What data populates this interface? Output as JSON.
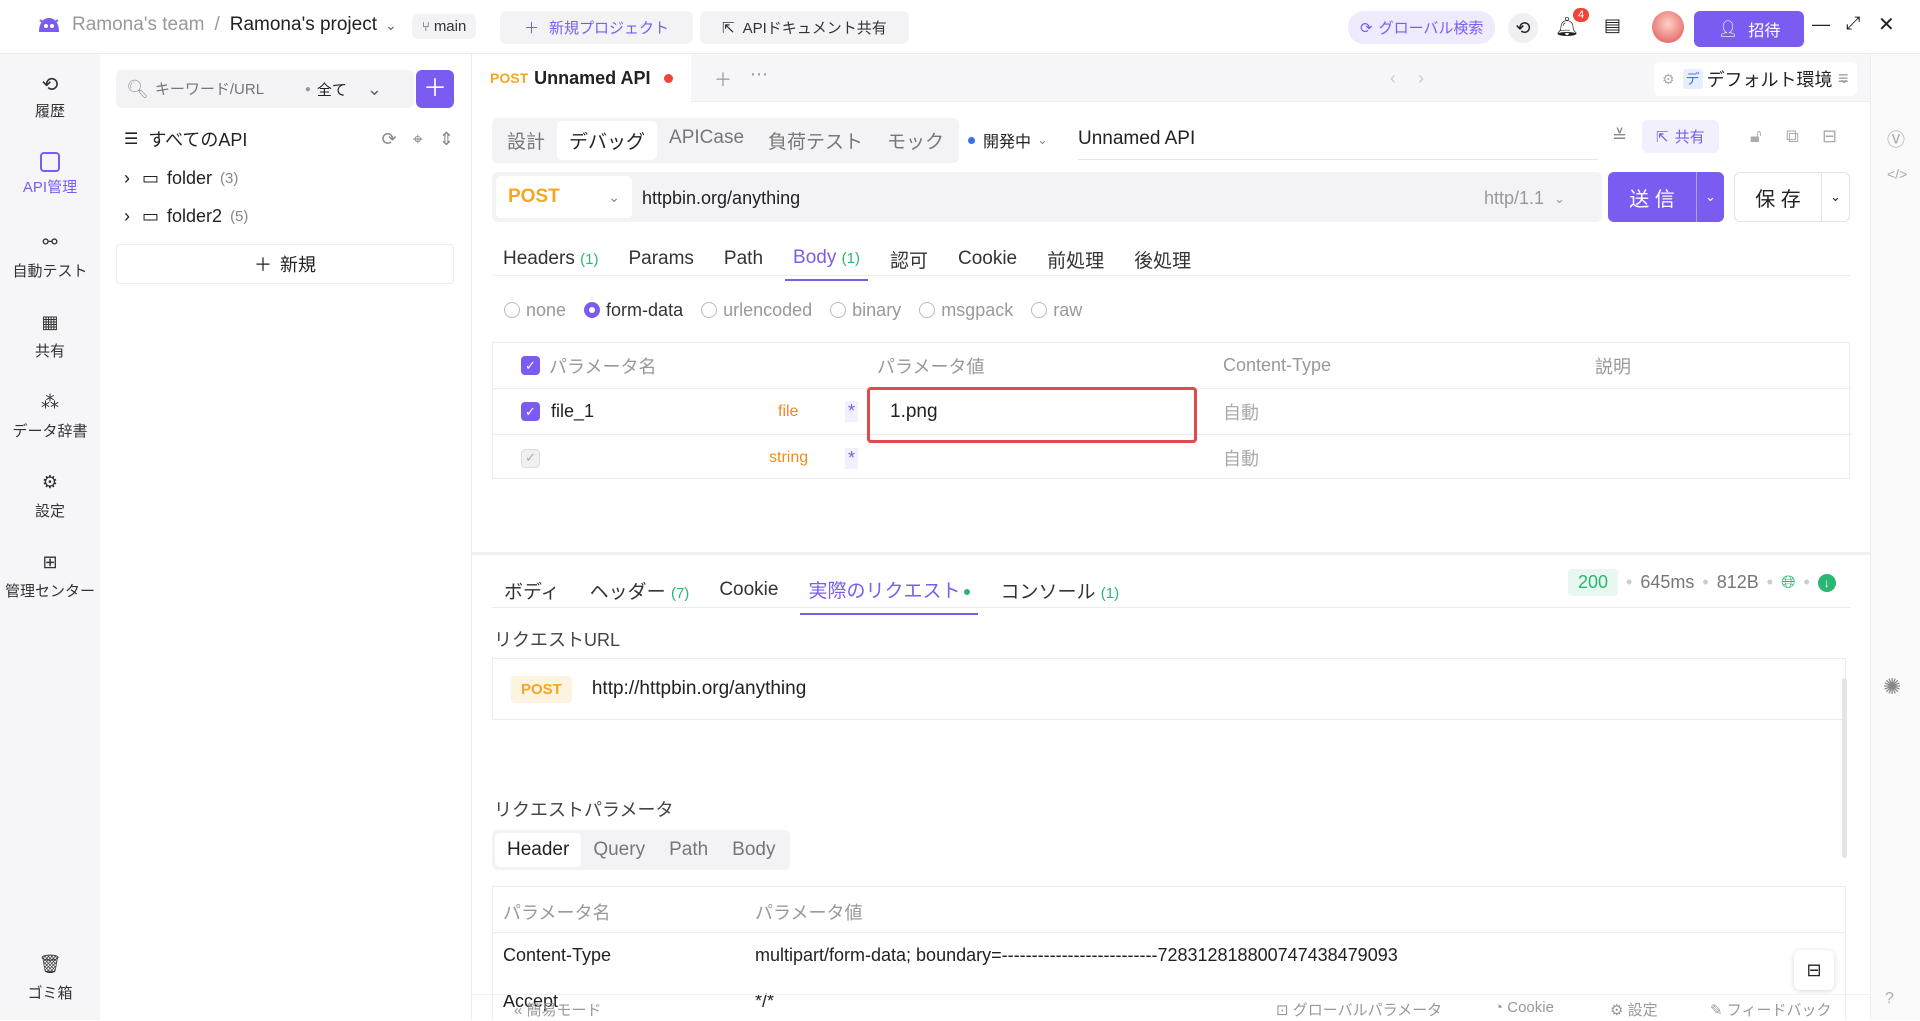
{
  "topbar": {
    "team": "Ramona's team",
    "separator": "/",
    "project": "Ramona's project",
    "branch": "main",
    "new_project": "新規プロジェクト",
    "share_doc": "APIドキュメント共有",
    "global_search": "グローバル検索",
    "notif_count": "4",
    "invite": "招待"
  },
  "leftnav": {
    "items": [
      {
        "label": "履歴",
        "icon": "history-icon"
      },
      {
        "label": "API管理",
        "icon": "api-management-icon"
      },
      {
        "label": "自動テスト",
        "icon": "auto-test-icon"
      },
      {
        "label": "共有",
        "icon": "share-icon"
      },
      {
        "label": "データ辞書",
        "icon": "data-dictionary-icon"
      },
      {
        "label": "設定",
        "icon": "settings-icon"
      },
      {
        "label": "管理センター",
        "icon": "admin-center-icon"
      }
    ],
    "trash": "ゴミ箱"
  },
  "sidebar": {
    "search_placeholder": "キーワード/URL",
    "filter": "全て",
    "all_apis": "すべてのAPI",
    "folders": [
      {
        "name": "folder",
        "count": "(3)"
      },
      {
        "name": "folder2",
        "count": "(5)"
      }
    ],
    "new_label": "新規"
  },
  "doc_tab": {
    "method": "POST",
    "title": "Unnamed API",
    "env": "デフォルト環境",
    "env_letter": "デ"
  },
  "mode_tabs": [
    "設計",
    "デバッグ",
    "APICase",
    "負荷テスト",
    "モック"
  ],
  "active_mode": "デバッグ",
  "status": "開発中",
  "api_name": "Unnamed API",
  "share_btn": "共有",
  "request": {
    "method": "POST",
    "url": "httpbin.org/anything",
    "protocol": "http/1.1",
    "send": "送 信",
    "save": "保 存"
  },
  "req_tabs": [
    {
      "label": "Headers",
      "badge": "(1)"
    },
    {
      "label": "Params",
      "badge": ""
    },
    {
      "label": "Path",
      "badge": ""
    },
    {
      "label": "Body",
      "badge": "(1)"
    },
    {
      "label": "認可",
      "badge": ""
    },
    {
      "label": "Cookie",
      "badge": ""
    },
    {
      "label": "前処理",
      "badge": ""
    },
    {
      "label": "後処理",
      "badge": ""
    }
  ],
  "body_types": [
    "none",
    "form-data",
    "urlencoded",
    "binary",
    "msgpack",
    "raw"
  ],
  "body_active": "form-data",
  "param_table": {
    "headers": [
      "パラメータ名",
      "パラメータ値",
      "Content-Type",
      "説明"
    ],
    "rows": [
      {
        "name": "file_1",
        "type": "file",
        "required": "*",
        "value": "1.png",
        "content_type": "自動",
        "checked": true
      },
      {
        "name": "",
        "type": "string",
        "required": "*",
        "value": "",
        "content_type": "自動",
        "checked": false
      }
    ]
  },
  "response": {
    "tabs": [
      {
        "label": "ボディ",
        "badge": ""
      },
      {
        "label": "ヘッダー",
        "badge": "(7)"
      },
      {
        "label": "Cookie",
        "badge": ""
      },
      {
        "label": "実際のリクエスト",
        "badge": ""
      },
      {
        "label": "コンソール",
        "badge": "(1)"
      }
    ],
    "status": "200",
    "time": "645ms",
    "size": "812B",
    "request_url_label": "リクエストURL",
    "method": "POST",
    "full_url": "http://httpbin.org/anything",
    "params_label": "リクエストパラメータ",
    "param_tabs": [
      "Header",
      "Query",
      "Path",
      "Body"
    ],
    "table_headers": [
      "パラメータ名",
      "パラメータ値"
    ],
    "rows": [
      {
        "name": "Content-Type",
        "value": "multipart/form-data; boundary=--------------------------728312818800747438479093"
      },
      {
        "name": "Accept",
        "value": "*/*"
      }
    ]
  },
  "footer": {
    "simple_mode": "簡易モード",
    "global_params": "グローバルパラメータ",
    "cookie": "Cookie",
    "settings": "設定",
    "feedback": "フィードバック"
  },
  "colors": {
    "accent": "#7b5cf0",
    "post": "#f5a623",
    "highlight_box": "#e53935",
    "success": "#2bb673"
  }
}
